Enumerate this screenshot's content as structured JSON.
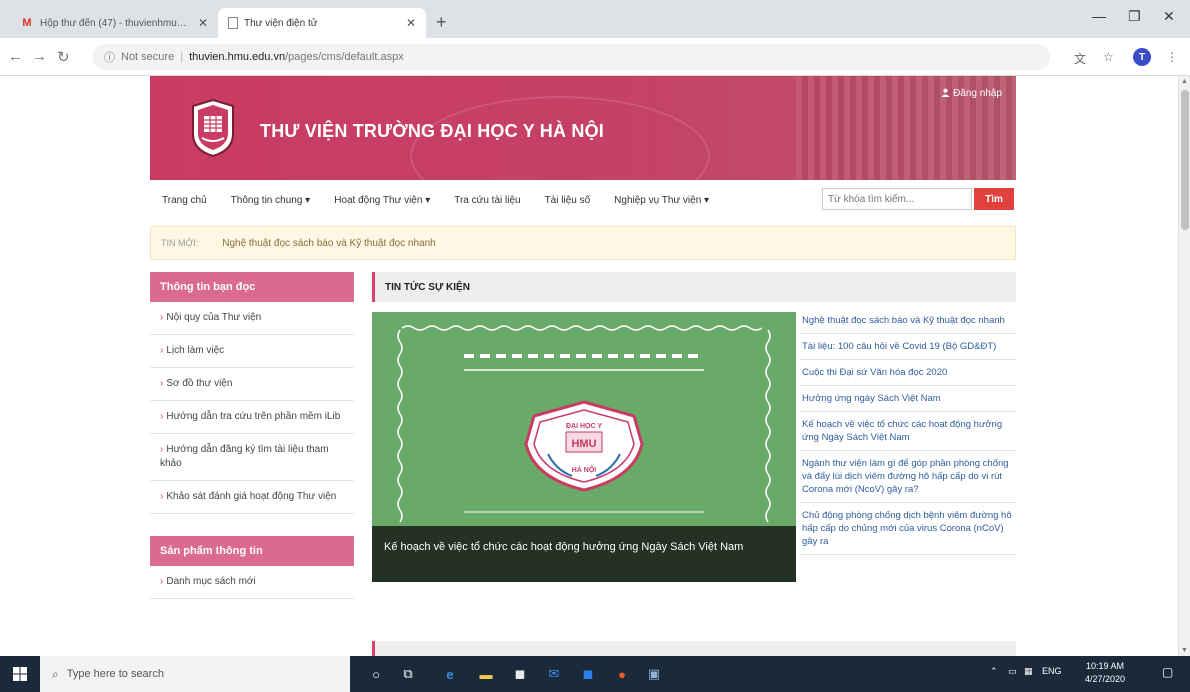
{
  "browser": {
    "tabs": [
      {
        "title": "Hộp thư đến (47) - thuvienhmu@..."
      },
      {
        "title": "Thư viện điện tử"
      }
    ],
    "new_tab": "+",
    "security_label": "Not secure",
    "url_host": "thuvien.hmu.edu.vn",
    "url_path": "/pages/cms/default.aspx",
    "avatar_letter": "T"
  },
  "site": {
    "title": "THƯ VIỆN TRƯỜNG ĐẠI HỌC Y HÀ NỘI",
    "login": "Đăng nhập",
    "colors": {
      "header": "#c93b63",
      "accent": "#d9436e",
      "sidebar_head": "#db6a92",
      "search_button": "#e2403c"
    }
  },
  "nav": {
    "items": [
      {
        "label": "Trang chủ"
      },
      {
        "label": "Thông tin chung ▾"
      },
      {
        "label": "Hoạt động Thư viện ▾"
      },
      {
        "label": "Tra cứu tài liệu"
      },
      {
        "label": "Tài liệu số"
      },
      {
        "label": "Nghiệp vụ Thư viện ▾"
      }
    ],
    "search_placeholder": "Từ khóa tìm kiếm...",
    "search_button": "Tìm"
  },
  "ticker": {
    "label": "TIN MỚI:",
    "text": "Nghệ thuật đọc sách báo và Kỹ thuật đọc nhanh"
  },
  "sidebar": {
    "box1_title": "Thông tin bạn đọc",
    "box1_items": [
      {
        "label": "Nội quy của Thư viện"
      },
      {
        "label": "Lịch làm việc"
      },
      {
        "label": "Sơ đồ thư viện"
      },
      {
        "label": "Hướng dẫn tra cứu trên phần mềm iLib"
      },
      {
        "label": "Hướng dẫn đăng ký tìm tài liệu tham khảo"
      },
      {
        "label": "Khảo sát đánh giá hoạt động Thư viện"
      }
    ],
    "box2_title": "Sản phẩm thông tin",
    "box2_items": [
      {
        "label": "Danh mục sách mới"
      }
    ]
  },
  "content": {
    "section_title": "TIN TỨC SỰ KIỆN",
    "feature_caption": "Kế hoạch về việc tổ chức các hoạt động hưởng ứng Ngày Sách Việt Nam",
    "logo_text_top": "ĐẠI HỌC Y",
    "logo_text_mid": "HMU",
    "logo_text_bottom": "HÀ NỘI",
    "news": [
      {
        "title": "Nghệ thuật đọc sách báo và Kỹ thuật đọc nhanh"
      },
      {
        "title": "Tài liệu: 100 câu hỏi về Covid 19 (Bộ GD&ĐT)"
      },
      {
        "title": "Cuộc thi Đại sứ Văn hóa đọc 2020"
      },
      {
        "title": "Hưởng ứng ngày Sách Việt Nam"
      },
      {
        "title": "Kế hoạch về việc tổ chức các hoạt động hưởng ứng Ngày Sách Việt Nam"
      },
      {
        "title": "Ngành thư viện làm gì để góp phần phòng chống và đẩy lùi dịch viêm đường hô hấp cấp do vi rút Corona mới (NcoV) gây ra?"
      },
      {
        "title": "Chủ động phòng chống dịch bệnh viêm đường hô hấp cấp do chủng mới của virus Corona (nCoV) gây ra"
      }
    ]
  },
  "taskbar": {
    "search_placeholder": "Type here to search",
    "language": "ENG",
    "time": "10:19 AM",
    "date": "4/27/2020"
  }
}
